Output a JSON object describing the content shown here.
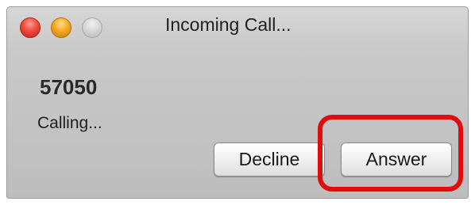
{
  "window": {
    "title": "Incoming Call...",
    "controls": [
      "close-icon",
      "minimize-icon",
      "zoom-icon"
    ]
  },
  "caller": {
    "number": "57050",
    "status": "Calling..."
  },
  "actions": {
    "decline_label": "Decline",
    "answer_label": "Answer"
  },
  "annotation": {
    "highlight_color": "#e10d0d"
  }
}
